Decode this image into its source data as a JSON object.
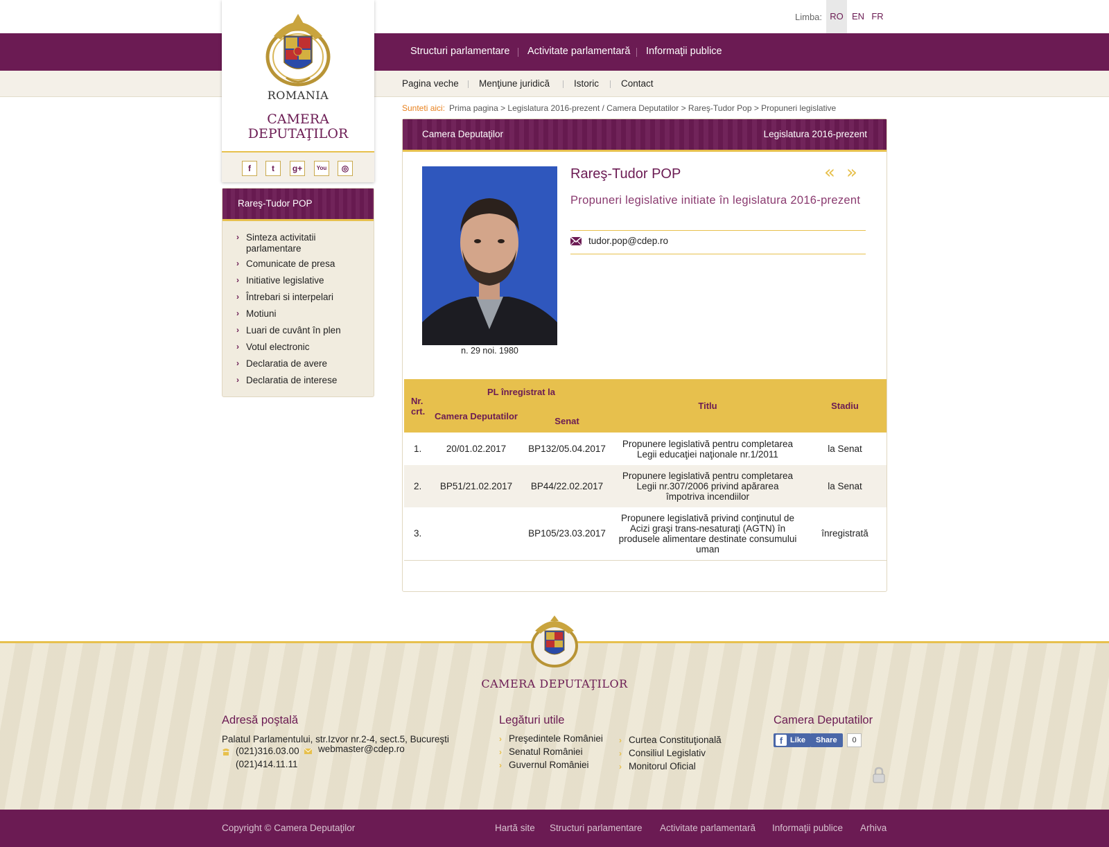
{
  "header": {
    "lang_label": "Limba:",
    "languages": [
      "RO",
      "EN",
      "FR"
    ],
    "active_language": "RO",
    "main_nav": [
      "Structuri parlamentare",
      "Activitate parlamentară",
      "Informaţii publice"
    ],
    "sub_nav": [
      "Pagina veche",
      "Menţiune juridică",
      "Istoric",
      "Contact"
    ]
  },
  "logo": {
    "romania": "ROMANIA",
    "camera": "CAMERA DEPUTAŢILOR",
    "social": [
      "facebook-icon",
      "twitter-icon",
      "google-plus-icon",
      "youtube-icon",
      "instagram-icon"
    ]
  },
  "sidebar": {
    "title": "Rareş-Tudor POP",
    "items": [
      "Sinteza activitatii parlamentare",
      "Comunicate de presa",
      "Initiative legislative",
      "Întrebari si interpelari",
      "Motiuni",
      "Luari de cuvânt în plen",
      "Votul electronic",
      "Declaratia de avere",
      "Declaratia de interese"
    ]
  },
  "breadcrumb": {
    "label": "Sunteti aici:",
    "path": "Prima pagina > Legislatura 2016-prezent / Camera Deputatilor > Rareş-Tudor Pop > Propuneri legislative"
  },
  "content": {
    "head_left": "Camera Deputaţilor",
    "head_right": "Legislatura 2016-prezent",
    "name": "Rareş-Tudor POP",
    "subtitle": "Propuneri legislative initiate în legislatura 2016-prezent",
    "email": "tudor.pop@cdep.ro",
    "birth": "n. 29 noi. 1980",
    "prev_arrow": "«",
    "next_arrow": "»"
  },
  "table": {
    "col_nr": "Nr. crt.",
    "col_group": "PL înregistrat la",
    "col_camera": "Camera Deputatilor",
    "col_senat": "Senat",
    "col_titlu": "Titlu",
    "col_stadiu": "Stadiu",
    "rows": [
      {
        "nr": "1.",
        "camera": "20/01.02.2017",
        "senat": "BP132/05.04.2017",
        "titlu": "Propunere legislativă pentru completarea Legii educaţiei naţionale nr.1/2011",
        "stadiu": "la Senat"
      },
      {
        "nr": "2.",
        "camera": "BP51/21.02.2017",
        "senat": "BP44/22.02.2017",
        "titlu": "Propunere legislativă pentru completarea Legii nr.307/2006 privind apărarea împotriva incendiilor",
        "stadiu": "la Senat"
      },
      {
        "nr": "3.",
        "camera": "",
        "senat": "BP105/23.03.2017",
        "titlu": "Propunere legislativă privind conţinutul de Acizi graşi trans-nesaturaţi (AGTN) în produsele alimentare destinate consumului uman",
        "stadiu": "înregistrată"
      }
    ]
  },
  "footer": {
    "camera": "CAMERA DEPUTAŢILOR",
    "address_title": "Adresă poştală",
    "address": "Palatul Parlamentului, str.Izvor nr.2-4, sect.5, Bucureşti",
    "phone1": "(021)316.03.00",
    "phone2": "(021)414.11.11",
    "email": "webmaster@cdep.ro",
    "links_title": "Legături utile",
    "links_col1": [
      "Preşedintele României",
      "Senatul României",
      "Guvernul României"
    ],
    "links_col2": [
      "Curtea Constituţională",
      "Consiliul Legislativ",
      "Monitorul Oficial"
    ],
    "social_title": "Camera Deputatilor",
    "fb_like": "Like",
    "fb_share": "Share",
    "fb_count": "0"
  },
  "bottom": {
    "copyright": "Copyright © Camera Deputaţilor",
    "links": [
      "Hartă site",
      "Structuri parlamentare",
      "Activitate parlamentară",
      "Informaţii publice",
      "Arhiva"
    ]
  },
  "colors": {
    "brand": "#6b1b53",
    "accent": "#e7c04d",
    "beige": "#f4f0e8"
  }
}
